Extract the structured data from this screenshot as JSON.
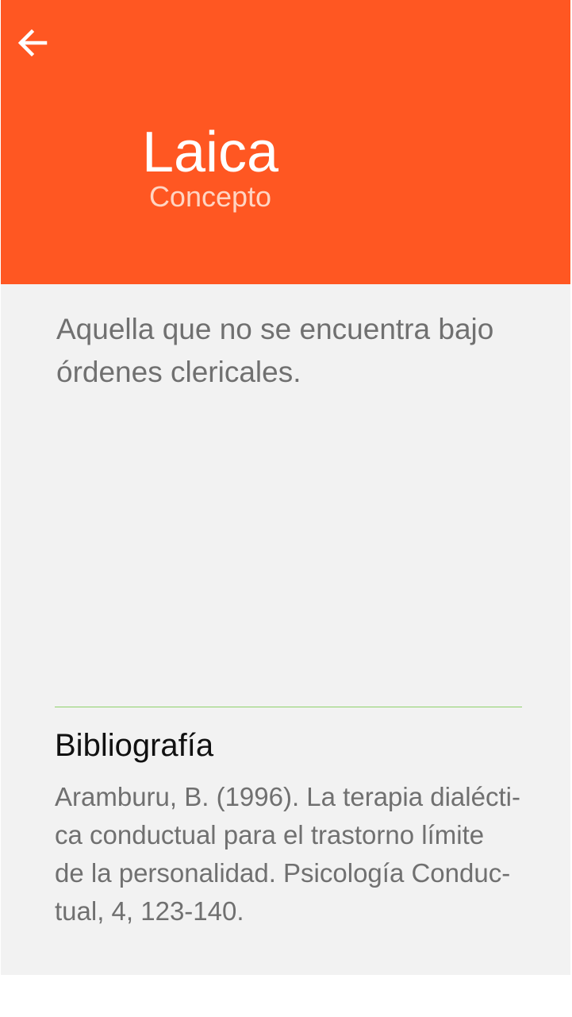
{
  "header": {
    "back_icon": "arrow-left-icon",
    "title": "Laica",
    "subtitle": "Concepto",
    "background_color": "#ff5722"
  },
  "content": {
    "definition_lines": [
      "Aquella que no se encuentra bajo",
      "órdenes clericales."
    ]
  },
  "bibliography": {
    "title": "Bibliografía",
    "lines": [
      "Aramburu, B. (1996). La terapia dialécti-",
      "ca conductual para el trastorno límite",
      "de la personalidad. Psicología Conduc-",
      "tual, 4, 123-140."
    ],
    "divider_color": "#8fd16a"
  }
}
